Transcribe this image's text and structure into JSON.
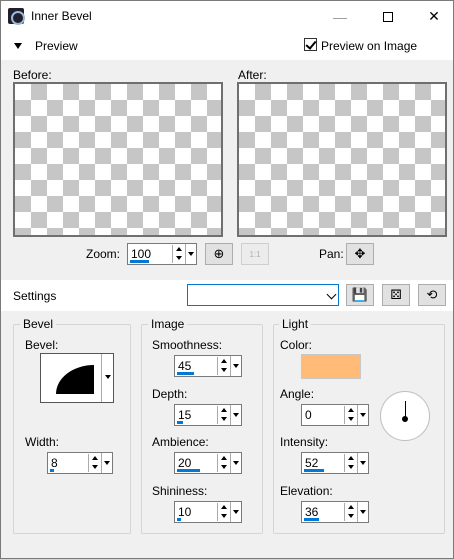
{
  "window": {
    "title": "Inner Bevel",
    "minimize_glyph": "—",
    "close_glyph": "✕"
  },
  "preview": {
    "toggle_label": "Preview",
    "preview_on_image_label": "Preview on Image",
    "preview_on_image_checked": true,
    "before_label": "Before:",
    "after_label": "After:",
    "zoom_label": "Zoom:",
    "zoom_value": "100",
    "zoom_level_fraction": 0.5,
    "pan_label": "Pan:",
    "actual_size_label": "1:1",
    "pan_glyph": "✥",
    "zoom_fit_glyph": "⊕"
  },
  "settings": {
    "label": "Settings",
    "preset_value": "",
    "save_glyph": "💾",
    "randomize_glyph": "⚄",
    "reset_glyph": "⟲"
  },
  "bevel": {
    "group_title": "Bevel",
    "bevel_label": "Bevel:",
    "width_label": "Width:",
    "width_value": "8",
    "width_level_fraction": 0.1
  },
  "image": {
    "group_title": "Image",
    "smoothness_label": "Smoothness:",
    "smoothness_value": "45",
    "smoothness_level_fraction": 0.45,
    "depth_label": "Depth:",
    "depth_value": "15",
    "depth_level_fraction": 0.15,
    "ambience_label": "Ambience:",
    "ambience_value": "20",
    "ambience_level_fraction": 0.6,
    "shininess_label": "Shininess:",
    "shininess_value": "10",
    "shininess_level_fraction": 0.1
  },
  "light": {
    "group_title": "Light",
    "color_label": "Color:",
    "color_value": "#ffbb77",
    "angle_label": "Angle:",
    "angle_value": "0",
    "angle_level_fraction": 0.0,
    "intensity_label": "Intensity:",
    "intensity_value": "52",
    "intensity_level_fraction": 0.52,
    "elevation_label": "Elevation:",
    "elevation_value": "36",
    "elevation_level_fraction": 0.4
  },
  "icons": {
    "app": "app-icon",
    "preview_toggle": "triangle-down-icon",
    "zoom_fit": "zoom-fit-icon",
    "actual_size": "actual-size-icon",
    "pan": "pan-move-icon",
    "save": "save-icon",
    "randomize": "dice-icon",
    "reset": "reset-icon"
  },
  "colors": {
    "accent": "#0078d7",
    "light_color": "#ffbb77",
    "checker_gray": "#c6c6c6"
  }
}
